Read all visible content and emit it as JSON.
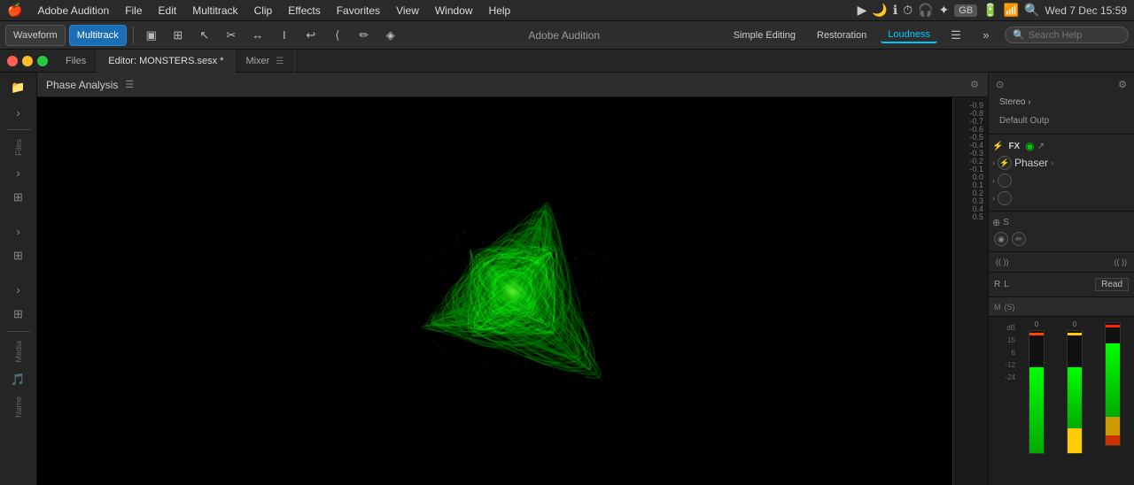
{
  "app": {
    "name": "Adobe Audition",
    "title": "Adobe Audition"
  },
  "menubar": {
    "apple": "🍎",
    "items": [
      "Adobe Audition",
      "File",
      "Edit",
      "Multitrack",
      "Clip",
      "Effects",
      "Favorites",
      "View",
      "Window",
      "Help"
    ],
    "datetime": "Wed 7 Dec  15:59"
  },
  "toolbar": {
    "modes": [
      {
        "label": "Waveform",
        "active": false
      },
      {
        "label": "Multitrack",
        "active": true
      }
    ],
    "title": "Adobe Audition",
    "workspaces": [
      {
        "label": "Simple Editing",
        "active": false
      },
      {
        "label": "Restoration",
        "active": false
      },
      {
        "label": "Loudness",
        "active": true
      }
    ],
    "search_placeholder": "Search Help"
  },
  "tabs": {
    "files_label": "Files",
    "editor_tab": "Editor: MONSTERS.sesx *",
    "mixer_tab": "Mixer"
  },
  "phase_panel": {
    "title": "Phase Analysis",
    "scale": [
      "-0.9",
      "-0.8",
      "-0.7",
      "-0.6",
      "-0.5",
      "-0.4",
      "-0.3",
      "-0.2",
      "-0.1",
      "0.0",
      "0.1",
      "0.2",
      "0.3",
      "0.4",
      "0.5"
    ]
  },
  "right_panel": {
    "channel": "Stereo ›",
    "output": "Default Outp",
    "fx_label": "FX",
    "effects": [
      {
        "name": "Phaser",
        "enabled": true
      }
    ],
    "automation": "Read",
    "channel_labels": [
      "R",
      "L"
    ],
    "meter_labels": [
      "M",
      "(S)"
    ],
    "db_labels": [
      "dB",
      "15",
      "6",
      "-12",
      "-24"
    ],
    "level_value": "0",
    "surround_labels": [
      "(( ))",
      "(( ))"
    ]
  }
}
